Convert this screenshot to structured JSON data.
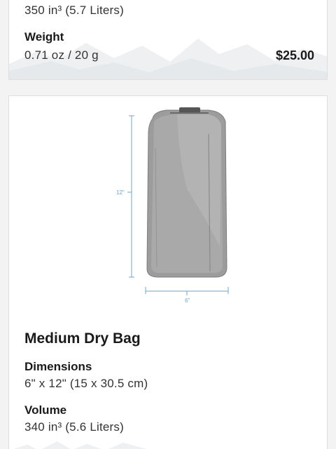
{
  "top_card": {
    "volume_value": "350 in³ (5.7 Liters)",
    "weight_label": "Weight",
    "weight_value": "0.71 oz / 20 g",
    "price": "$25.00"
  },
  "main_card": {
    "height_dimension": "12\"",
    "width_dimension": "6\"",
    "product_name": "Medium Dry Bag",
    "dimensions_label": "Dimensions",
    "dimensions_value": "6\" x 12\" (15 x 30.5 cm)",
    "volume_label": "Volume",
    "volume_value": "340 in³ (5.6 Liters)"
  },
  "colors": {
    "page_bg": "#f3f3f3",
    "card_bg": "#ffffff",
    "dimension_line": "#6aa7cc",
    "bag_fill": "#9a9a9a"
  }
}
